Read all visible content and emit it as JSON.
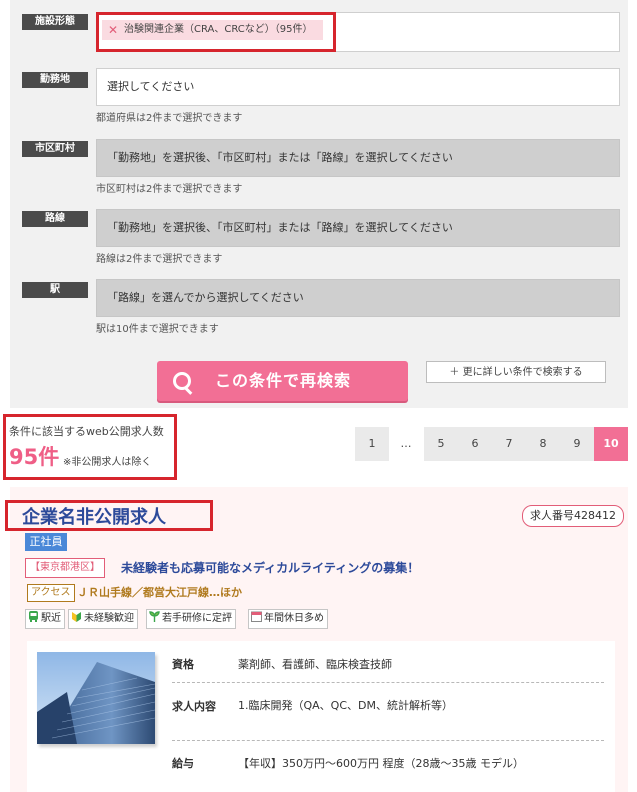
{
  "form": {
    "rows": [
      {
        "label": "施設形態",
        "chip": "治験関連企業（CRA、CRCなど）（95件）"
      },
      {
        "label": "勤務地",
        "value": "選択してください",
        "note": "都道府県は2件まで選択できます"
      },
      {
        "label": "市区町村",
        "value": "「勤務地」を選択後、「市区町村」または「路線」を選択してください",
        "note": "市区町村は2件まで選択できます"
      },
      {
        "label": "路線",
        "value": "「勤務地」を選択後、「市区町村」または「路線」を選択してください",
        "note": "路線は2件まで選択できます"
      },
      {
        "label": "駅",
        "value": "「路線」を選んでから選択してください",
        "note": "駅は10件まで選択できます"
      }
    ],
    "search_button": "この条件で再検索",
    "detail_button": "＋ 更に詳しい条件で検索する"
  },
  "results": {
    "label": "条件に該当するweb公開求人数",
    "count": "95件",
    "note": "※非公開求人は除く"
  },
  "pagination": {
    "pages": [
      "1",
      "…",
      "5",
      "6",
      "7",
      "8",
      "9",
      "10"
    ],
    "active": "10"
  },
  "job": {
    "company": "企業名非公開求人",
    "job_number": "求人番号428412",
    "employment": "正社員",
    "location": "【東京都港区】",
    "catch": "未経験者も応募可能なメディカルライティングの募集！",
    "access_label": "アクセス",
    "access": "ＪＲ山手線／都営大江戸線…ほか",
    "tags": [
      "駅近",
      "未経験歓迎",
      "若手研修に定評",
      "年間休日多め"
    ],
    "details": [
      {
        "label": "資格",
        "value": "薬剤師、看護師、臨床検査技師"
      },
      {
        "label": "求人内容",
        "value": "1.臨床開発（QA、QC、DM、統計解析等）"
      },
      {
        "label": "給与",
        "value": "【年収】350万円～600万円 程度（28歳～35歳 モデル）"
      }
    ]
  },
  "colors": {
    "accent": "#f26f95",
    "highlight": "#d6252d",
    "company": "#2d4a9a",
    "access": "#b07a1e"
  },
  "icons": [
    "close-icon",
    "search-icon",
    "train-icon",
    "beginner-icon",
    "sprout-icon",
    "calendar-icon"
  ]
}
